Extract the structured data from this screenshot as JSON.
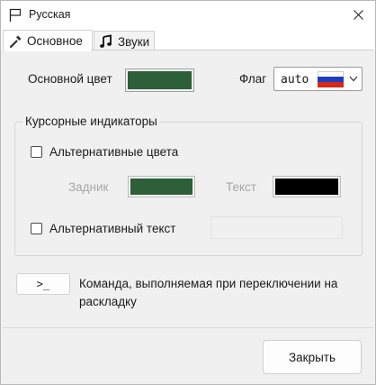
{
  "window": {
    "title": "Русская"
  },
  "tabs": [
    {
      "label": "Основное",
      "icon": "wrench-icon",
      "active": true
    },
    {
      "label": "Звуки",
      "icon": "music-note-icon",
      "active": false
    }
  ],
  "main": {
    "main_color_label": "Основной цвет",
    "main_color": "#2d5f38",
    "flag_label": "Флаг",
    "flag_value": "auto",
    "flag_icon": "russia-flag-icon",
    "flag_colors": [
      "#ffffff",
      "#1f3fbf",
      "#d62718"
    ]
  },
  "cursor_group": {
    "title": "Курсорные индикаторы",
    "alt_colors_label": "Альтернативные цвета",
    "alt_colors_checked": false,
    "background_label": "Задник",
    "background_color": "#2d5f38",
    "text_label": "Текст",
    "text_color": "#000000",
    "alt_text_label": "Альтернативный текст",
    "alt_text_checked": false,
    "alt_text_value": ""
  },
  "command": {
    "button_label": ">_",
    "description": "Команда, выполняемая при переключении на раскладку"
  },
  "footer": {
    "close_label": "Закрыть"
  }
}
